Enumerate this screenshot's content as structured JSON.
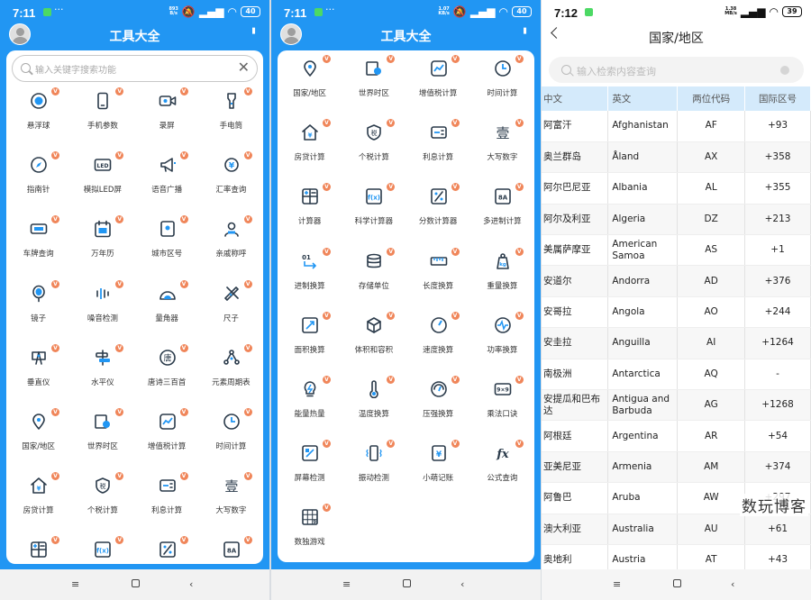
{
  "status_bar": {
    "p1": {
      "time": "7:11",
      "speed_top": "893",
      "speed_bottom": "B/s",
      "battery": "40"
    },
    "p2": {
      "time": "7:11",
      "speed_top": "1.07",
      "speed_bottom": "KB/s",
      "battery": "40"
    },
    "p3": {
      "time": "7:12",
      "speed_top": "1.38",
      "speed_bottom": "MB/s",
      "battery": "39"
    },
    "more": "···"
  },
  "app_title": "工具大全",
  "search": {
    "placeholder": "输入关键字搜索功能"
  },
  "badge": "V",
  "tools_p1": [
    {
      "label": "悬浮球",
      "icon": "floating-ball-icon"
    },
    {
      "label": "手机参数",
      "icon": "phone-icon"
    },
    {
      "label": "录屏",
      "icon": "video-record-icon"
    },
    {
      "label": "手电筒",
      "icon": "flashlight-icon"
    },
    {
      "label": "指南针",
      "icon": "compass-icon"
    },
    {
      "label": "模拟LED屏",
      "icon": "led-icon"
    },
    {
      "label": "语音广播",
      "icon": "megaphone-icon"
    },
    {
      "label": "汇率查询",
      "icon": "currency-icon"
    },
    {
      "label": "车牌查询",
      "icon": "license-plate-icon"
    },
    {
      "label": "万年历",
      "icon": "calendar-icon"
    },
    {
      "label": "城市区号",
      "icon": "city-code-icon"
    },
    {
      "label": "亲戚称呼",
      "icon": "relatives-icon"
    },
    {
      "label": "镜子",
      "icon": "mirror-icon"
    },
    {
      "label": "噪音检测",
      "icon": "noise-icon"
    },
    {
      "label": "量角器",
      "icon": "protractor-icon"
    },
    {
      "label": "尺子",
      "icon": "ruler-icon"
    },
    {
      "label": "垂直仪",
      "icon": "plumb-icon"
    },
    {
      "label": "水平仪",
      "icon": "level-icon"
    },
    {
      "label": "唐诗三百首",
      "icon": "poem-icon"
    },
    {
      "label": "元素周期表",
      "icon": "periodic-icon"
    },
    {
      "label": "国家/地区",
      "icon": "location-icon"
    },
    {
      "label": "世界时区",
      "icon": "world-time-icon"
    },
    {
      "label": "增值税计算",
      "icon": "vat-icon"
    },
    {
      "label": "时间计算",
      "icon": "clock-icon"
    },
    {
      "label": "房贷计算",
      "icon": "mortgage-icon"
    },
    {
      "label": "个税计算",
      "icon": "tax-icon"
    },
    {
      "label": "利息计算",
      "icon": "interest-icon"
    },
    {
      "label": "大写数字",
      "icon": "uppercase-number-icon"
    },
    {
      "label": "",
      "icon": "calculator-icon"
    },
    {
      "label": "",
      "icon": "sci-calc-icon"
    },
    {
      "label": "",
      "icon": "fraction-icon"
    },
    {
      "label": "",
      "icon": "base-calc-icon"
    }
  ],
  "tools_p2": [
    {
      "label": "国家/地区",
      "icon": "location-icon"
    },
    {
      "label": "世界时区",
      "icon": "world-time-icon"
    },
    {
      "label": "增值税计算",
      "icon": "vat-icon"
    },
    {
      "label": "时间计算",
      "icon": "clock-icon"
    },
    {
      "label": "房贷计算",
      "icon": "mortgage-icon"
    },
    {
      "label": "个税计算",
      "icon": "tax-icon"
    },
    {
      "label": "利息计算",
      "icon": "interest-icon"
    },
    {
      "label": "大写数字",
      "icon": "uppercase-number-icon"
    },
    {
      "label": "计算器",
      "icon": "calculator-icon"
    },
    {
      "label": "科学计算器",
      "icon": "sci-calc-icon"
    },
    {
      "label": "分数计算器",
      "icon": "fraction-icon"
    },
    {
      "label": "多进制计算",
      "icon": "base-calc-icon"
    },
    {
      "label": "进制换算",
      "icon": "base-convert-icon"
    },
    {
      "label": "存储单位",
      "icon": "storage-icon"
    },
    {
      "label": "长度换算",
      "icon": "length-icon"
    },
    {
      "label": "重量换算",
      "icon": "weight-icon"
    },
    {
      "label": "面积换算",
      "icon": "area-icon"
    },
    {
      "label": "体积和容积",
      "icon": "volume-icon"
    },
    {
      "label": "速度换算",
      "icon": "speed-icon"
    },
    {
      "label": "功率换算",
      "icon": "power-icon"
    },
    {
      "label": "能量热量",
      "icon": "energy-icon"
    },
    {
      "label": "温度换算",
      "icon": "temperature-icon"
    },
    {
      "label": "压强换算",
      "icon": "pressure-icon"
    },
    {
      "label": "乘法口诀",
      "icon": "multiplication-icon"
    },
    {
      "label": "屏幕检测",
      "icon": "screen-test-icon"
    },
    {
      "label": "振动检测",
      "icon": "vibration-icon"
    },
    {
      "label": "小萌记账",
      "icon": "ledger-icon"
    },
    {
      "label": "公式查询",
      "icon": "formula-icon"
    },
    {
      "label": "数独游戏",
      "icon": "sudoku-icon"
    }
  ],
  "country_page": {
    "title": "国家/地区",
    "search_placeholder": "输入检索内容查询",
    "headers": [
      "中文",
      "英文",
      "两位代码",
      "国际区号"
    ],
    "rows": [
      [
        "阿富汗",
        "Afghanistan",
        "AF",
        "+93"
      ],
      [
        "奥兰群岛",
        "Åland",
        "AX",
        "+358"
      ],
      [
        "阿尔巴尼亚",
        "Albania",
        "AL",
        "+355"
      ],
      [
        "阿尔及利亚",
        "Algeria",
        "DZ",
        "+213"
      ],
      [
        "美属萨摩亚",
        "American Samoa",
        "AS",
        "+1"
      ],
      [
        "安道尔",
        "Andorra",
        "AD",
        "+376"
      ],
      [
        "安哥拉",
        "Angola",
        "AO",
        "+244"
      ],
      [
        "安圭拉",
        "Anguilla",
        "AI",
        "+1264"
      ],
      [
        "南极洲",
        "Antarctica",
        "AQ",
        "-"
      ],
      [
        "安提瓜和巴布达",
        "Antigua and Barbuda",
        "AG",
        "+1268"
      ],
      [
        "阿根廷",
        "Argentina",
        "AR",
        "+54"
      ],
      [
        "亚美尼亚",
        "Armenia",
        "AM",
        "+374"
      ],
      [
        "阿鲁巴",
        "Aruba",
        "AW",
        "+297"
      ],
      [
        "澳大利亚",
        "Australia",
        "AU",
        "+61"
      ],
      [
        "奥地利",
        "Austria",
        "AT",
        "+43"
      ]
    ]
  },
  "watermark": "数玩博客",
  "colors": {
    "primary": "#2196f3",
    "badge": "#f0865a",
    "table_header": "#d4eafb"
  }
}
